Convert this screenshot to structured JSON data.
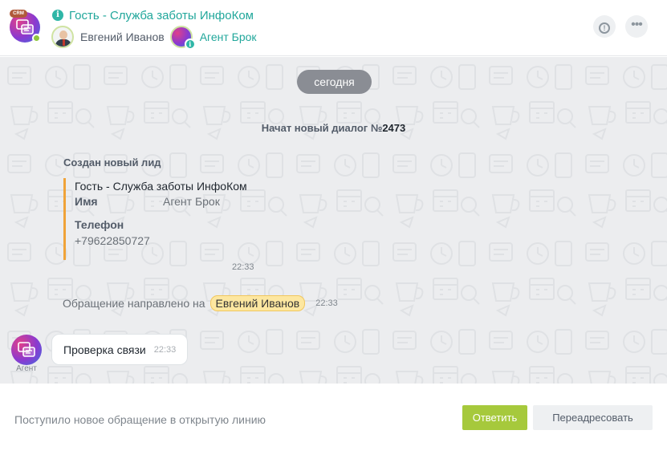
{
  "header": {
    "crm_badge": "CRM",
    "chat_title": "Гость - Служба заботы ИнфоКом",
    "members": [
      {
        "name": "Евгений Иванов"
      },
      {
        "name": "Агент Брок"
      }
    ],
    "icons": {
      "info": "info-icon",
      "alert": "alert-icon",
      "more": "more-icon"
    },
    "alert_glyph": "!",
    "more_glyph": "•••",
    "info_glyph": "i"
  },
  "feed": {
    "date_label": "сегодня",
    "dialog_start_prefix": "Начат новый диалог №",
    "dialog_number": "2473",
    "lead": {
      "title": "Создан новый лид",
      "name_line": "Гость - Служба заботы ИнфоКом",
      "name_label": "Имя",
      "name_value": "Агент Брок",
      "phone_label": "Телефон",
      "phone_value": "+79622850727",
      "time": "22:33"
    },
    "routed": {
      "text": "Обращение направлено на",
      "user": "Евгений Иванов",
      "time": "22:33"
    },
    "message": {
      "author": "Агент",
      "text": "Проверка связи",
      "time": "22:33"
    }
  },
  "footer": {
    "status_text": "Поступило новое обращение в открытую линию",
    "answer_label": "Ответить",
    "redirect_label": "Переадресовать"
  },
  "colors": {
    "accent": "#21a79b",
    "answer_button": "#a6c93c",
    "lead_border": "#f0a339",
    "feed_background": "#ecedef"
  }
}
